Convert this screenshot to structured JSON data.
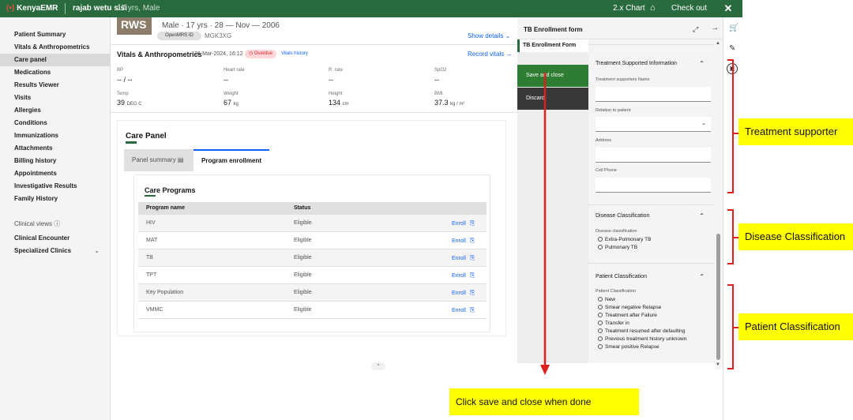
{
  "topbar": {
    "brand": "KenyaEMR",
    "patient_name": "rajab wetu sisi",
    "patient_info": "17 yrs, Male",
    "chart_label": "2.x Chart",
    "checkout_label": "Check out"
  },
  "patient": {
    "avatar_initials": "RWS",
    "demographics": "Male · 17 yrs · 28 — Nov — 2006",
    "id_label": "OpenMRS ID",
    "id_value": "MGK3XG",
    "show_details": "Show details"
  },
  "nav": {
    "items": [
      "Patient Summary",
      "Vitals & Anthropometrics",
      "Care panel",
      "Medications",
      "Results Viewer",
      "Visits",
      "Allergies",
      "Conditions",
      "Immunizations",
      "Attachments",
      "Billing history",
      "Appointments",
      "Investigative Results",
      "Family History"
    ],
    "clinical_views": "Clinical views",
    "clinical_encounter": "Clinical Encounter",
    "specialized_clinics": "Specialized Clinics"
  },
  "vitals": {
    "title": "Vitals & Anthropometrics",
    "date": "26-Mar-2024, 16:12",
    "overdue": "Overdue",
    "history": "Vitals history",
    "record": "Record vitals",
    "fields": [
      {
        "label": "BP",
        "value": "-- / --",
        "unit": ""
      },
      {
        "label": "Heart rate",
        "value": "--",
        "unit": ""
      },
      {
        "label": "R. rate",
        "value": "--",
        "unit": ""
      },
      {
        "label": "SpO2",
        "value": "--",
        "unit": ""
      },
      {
        "label": "Temp",
        "value": "39",
        "unit": "DEG C"
      },
      {
        "label": "Weight",
        "value": "67",
        "unit": "kg"
      },
      {
        "label": "Height",
        "value": "134",
        "unit": "cm"
      },
      {
        "label": "BMI",
        "value": "37.3",
        "unit": "kg / m²"
      }
    ]
  },
  "care_panel": {
    "title": "Care Panel",
    "tab_summary": "Panel summary",
    "tab_enrollment": "Program enrollment",
    "programs_title": "Care Programs",
    "col_name": "Program name",
    "col_status": "Status",
    "rows": [
      {
        "name": "HIV",
        "status": "Eligible",
        "action": "Enroll"
      },
      {
        "name": "MAT",
        "status": "Eligible",
        "action": "Enroll"
      },
      {
        "name": "TB",
        "status": "Eligible",
        "action": "Enroll"
      },
      {
        "name": "TPT",
        "status": "Eligible",
        "action": "Enroll"
      },
      {
        "name": "Key Population",
        "status": "Eligible",
        "action": "Enroll"
      },
      {
        "name": "VMMC",
        "status": "Eligible",
        "action": "Enroll"
      }
    ]
  },
  "tb_form": {
    "panel_title": "TB Enrollment form",
    "form_tab": "TB Enrollment Form",
    "save_label": "Save and close",
    "discard_label": "Discard",
    "treatment_section": "Treatment Supported Information",
    "supporter_name_label": "Treatment supporters Name",
    "relation_label": "Relation to patient",
    "address_label": "Address",
    "cell_label": "Cell Phone",
    "disease_section": "Disease Classification",
    "disease_label": "Disease classification",
    "disease_options": [
      "Extra-Pulmonary TB",
      "Pulmonary TB"
    ],
    "patient_section": "Patient Classification",
    "patient_label": "Patient Classification",
    "patient_options": [
      "New",
      "Smear negative Relapse",
      "Treatment after Failure",
      "Transfer in",
      "Treatment resumed after defaulting",
      "Previous treatment history unknown",
      "Smear positive Relapse"
    ]
  },
  "annotations": {
    "treatment": "Treatment supporter",
    "disease": "Disease Classification",
    "patient": "Patient Classification",
    "save": "Click save and close when done"
  },
  "colors": {
    "brand_green": "#2a6a3f",
    "link_blue": "#0f62fe",
    "annotation_red": "#e02020",
    "annotation_yellow": "#ffff00"
  }
}
